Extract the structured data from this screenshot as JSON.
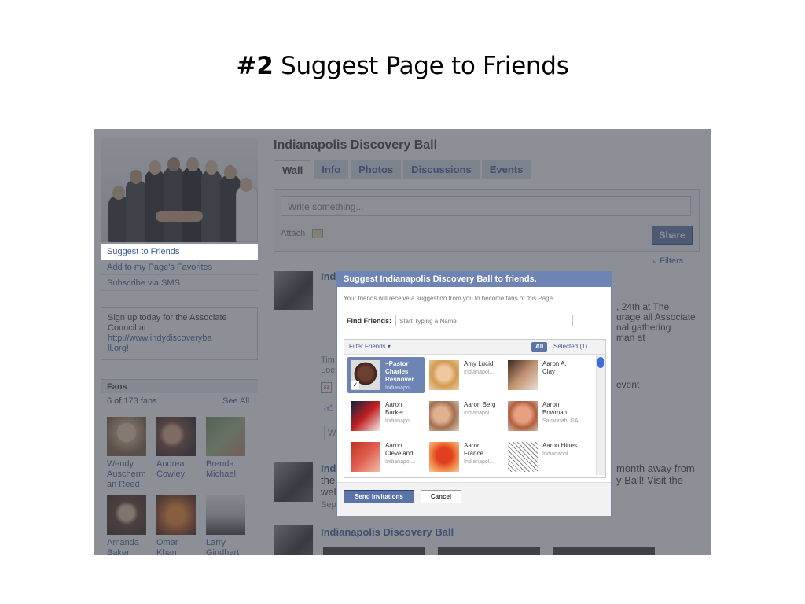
{
  "slide": {
    "number": "#2",
    "title": "Suggest Page to Friends"
  },
  "sidebar": {
    "links": [
      "Suggest to Friends",
      "Add to my Page's Favorites",
      "Subscribe via SMS"
    ],
    "signup_text": "Sign up today for the Associate Council at",
    "signup_url_line1": "http://www.indydiscoveryba",
    "signup_url_line2": "ll.org!",
    "fans_title": "Fans",
    "fans_count_prefix": "6 of ",
    "fans_count_link": "173 fans",
    "see_all": "See All",
    "fans": [
      {
        "first": "Wendy",
        "last": "Auscherm",
        "extra": "an Reed"
      },
      {
        "first": "Andrea",
        "last": "Cowley",
        "extra": ""
      },
      {
        "first": "Brenda",
        "last": "Michael",
        "extra": ""
      },
      {
        "first": "Amanda",
        "last": "Baker",
        "extra": ""
      },
      {
        "first": "Omar",
        "last": "Khan",
        "extra": ""
      },
      {
        "first": "Larry",
        "last": "Gindhart",
        "extra": ""
      }
    ]
  },
  "page": {
    "name": "Indianapolis Discovery Ball",
    "tabs": [
      "Wall",
      "Info",
      "Photos",
      "Discussions",
      "Events"
    ],
    "composer_placeholder": "Write something...",
    "attach": "Attach",
    "share": "Share",
    "filters": "Filters"
  },
  "feed": {
    "post1_frag": "Ind",
    "post1_right1": ", 24th at The",
    "post1_right2": "urage all Associate",
    "post1_right3": "nal gathering",
    "post1_right4": "man at",
    "post1_left1": "Tim",
    "post1_left2": "Loc",
    "post1_event": "event",
    "post1_w": "W",
    "post2_frag1": "Ind",
    "post2_frag2": "the",
    "post2_frag3": "wel",
    "post2_frag4": "Sep",
    "post2_right1": "month away from",
    "post2_right2": "y Ball! Visit the",
    "post3_title": "Indianapolis Discovery Ball"
  },
  "dialog": {
    "title": "Suggest Indianapolis Discovery Ball to friends.",
    "subtitle": "Your friends will receive a suggestion from you to become fans of this Page.",
    "find_label": "Find Friends:",
    "find_placeholder": "Start Typing a Name",
    "filter_friends": "Filter Friends",
    "all": "All",
    "selected": "Selected (1)",
    "friends": [
      {
        "line1": "~Pastor",
        "line2": "Charles",
        "line3": "Resnover",
        "loc": "Indianapol..."
      },
      {
        "line1": "Amy Lucid",
        "line2": "",
        "line3": "",
        "loc": "Indianapol..."
      },
      {
        "line1": "Aaron A.",
        "line2": "Clay",
        "line3": "",
        "loc": ""
      },
      {
        "line1": "Aaron",
        "line2": "Barker",
        "line3": "",
        "loc": "Indianapol..."
      },
      {
        "line1": "Aaron Berg",
        "line2": "",
        "line3": "",
        "loc": "Indianapol..."
      },
      {
        "line1": "Aaron",
        "line2": "Bowman",
        "line3": "",
        "loc": "Savannah, GA"
      },
      {
        "line1": "Aaron",
        "line2": "Cleveland",
        "line3": "",
        "loc": "Indianapol..."
      },
      {
        "line1": "Aaron",
        "line2": "France",
        "line3": "",
        "loc": "Indianapol..."
      },
      {
        "line1": "Aaron Hines",
        "line2": "",
        "line3": "",
        "loc": "Indianapol..."
      }
    ],
    "send": "Send Invitations",
    "cancel": "Cancel"
  },
  "colors": {
    "facebook_blue": "#3b5998",
    "dialog_header": "#6d84b4",
    "button": "#5b74a8"
  }
}
